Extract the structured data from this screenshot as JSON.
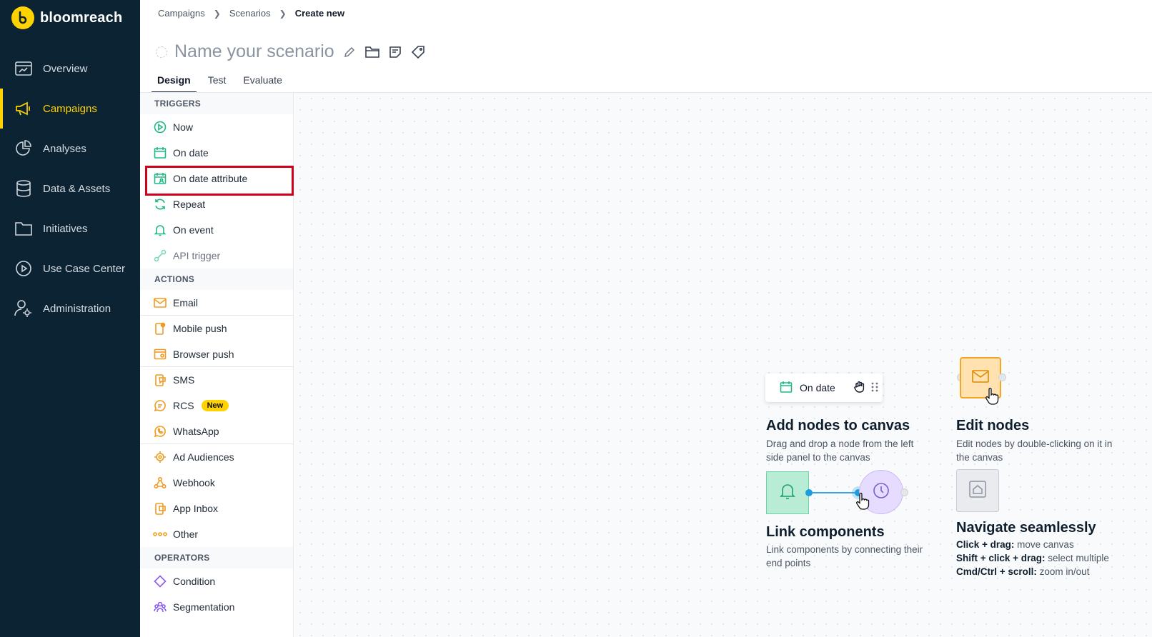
{
  "app": {
    "brand": "bloomreach",
    "accent": "#ffd200"
  },
  "sidebar": {
    "items": [
      {
        "label": "Overview",
        "icon": "overview-icon"
      },
      {
        "label": "Campaigns",
        "icon": "megaphone-icon",
        "active": true
      },
      {
        "label": "Analyses",
        "icon": "pie-chart-icon"
      },
      {
        "label": "Data & Assets",
        "icon": "database-icon"
      },
      {
        "label": "Initiatives",
        "icon": "folder-icon"
      },
      {
        "label": "Use Case Center",
        "icon": "play-circle-icon"
      },
      {
        "label": "Administration",
        "icon": "user-settings-icon"
      }
    ]
  },
  "breadcrumb": {
    "items": [
      "Campaigns",
      "Scenarios"
    ],
    "current": "Create new"
  },
  "scenario": {
    "title": "Name your scenario"
  },
  "tabs": [
    "Design",
    "Test",
    "Evaluate"
  ],
  "panel": {
    "triggers_header": "TRIGGERS",
    "triggers": [
      "Now",
      "On date",
      "On date attribute",
      "Repeat",
      "On event",
      "API trigger"
    ],
    "actions_header": "ACTIONS",
    "actions": [
      "Email",
      "Mobile push",
      "Browser push",
      "SMS",
      "RCS",
      "WhatsApp",
      "Ad Audiences",
      "Webhook",
      "App Inbox",
      "Other"
    ],
    "rcs_badge": "New",
    "operators_header": "OPERATORS",
    "operators": [
      "Condition",
      "Segmentation"
    ]
  },
  "canvas": {
    "chip_label": "On date",
    "add_nodes": {
      "title": "Add nodes to canvas",
      "desc1": "Drag and drop a node from the left",
      "desc2": "side panel to the canvas"
    },
    "edit_nodes": {
      "title": "Edit nodes",
      "desc1": "Edit nodes by double-clicking on it in",
      "desc2": "the canvas"
    },
    "link": {
      "title": "Link components",
      "desc1": "Link components by connecting their",
      "desc2": "end points"
    },
    "navigate": {
      "title": "Navigate seamlessly",
      "s1_key": "Click + drag:",
      "s1_val": " move canvas",
      "s2_key": "Shift + click + drag:",
      "s2_val": " select multiple",
      "s3_key": "Cmd/Ctrl + scroll:",
      "s3_val": " zoom in/out"
    }
  }
}
